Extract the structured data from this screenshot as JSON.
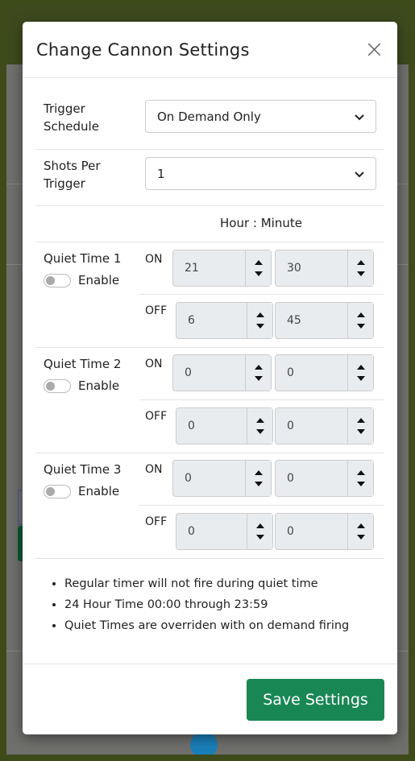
{
  "modal": {
    "title": "Change Cannon Settings",
    "close_glyph": "×"
  },
  "trigger_schedule": {
    "label_line1": "Trigger",
    "label_line2": "Schedule",
    "value": "On Demand Only"
  },
  "shots_per_trigger": {
    "label_line1": "Shots Per",
    "label_line2": "Trigger",
    "value": "1"
  },
  "time_header": "Hour : Minute",
  "quiet_times": [
    {
      "label": "Quiet Time 1",
      "enable_label": "Enable",
      "enabled": false,
      "on_label": "ON",
      "off_label": "OFF",
      "on_hour": "21",
      "on_minute": "30",
      "off_hour": "6",
      "off_minute": "45"
    },
    {
      "label": "Quiet Time 2",
      "enable_label": "Enable",
      "enabled": false,
      "on_label": "ON",
      "off_label": "OFF",
      "on_hour": "0",
      "on_minute": "0",
      "off_hour": "0",
      "off_minute": "0"
    },
    {
      "label": "Quiet Time 3",
      "enable_label": "Enable",
      "enabled": false,
      "on_label": "ON",
      "off_label": "OFF",
      "on_hour": "0",
      "on_minute": "0",
      "off_hour": "0",
      "off_minute": "0"
    }
  ],
  "notes": [
    "Regular timer will not fire during quiet time",
    "24 Hour Time 00:00 through 23:59",
    "Quiet Times are overriden with on demand firing"
  ],
  "save_label": "Save Settings",
  "colors": {
    "primary_button": "#198754",
    "backdrop": "#3d4a1a"
  }
}
